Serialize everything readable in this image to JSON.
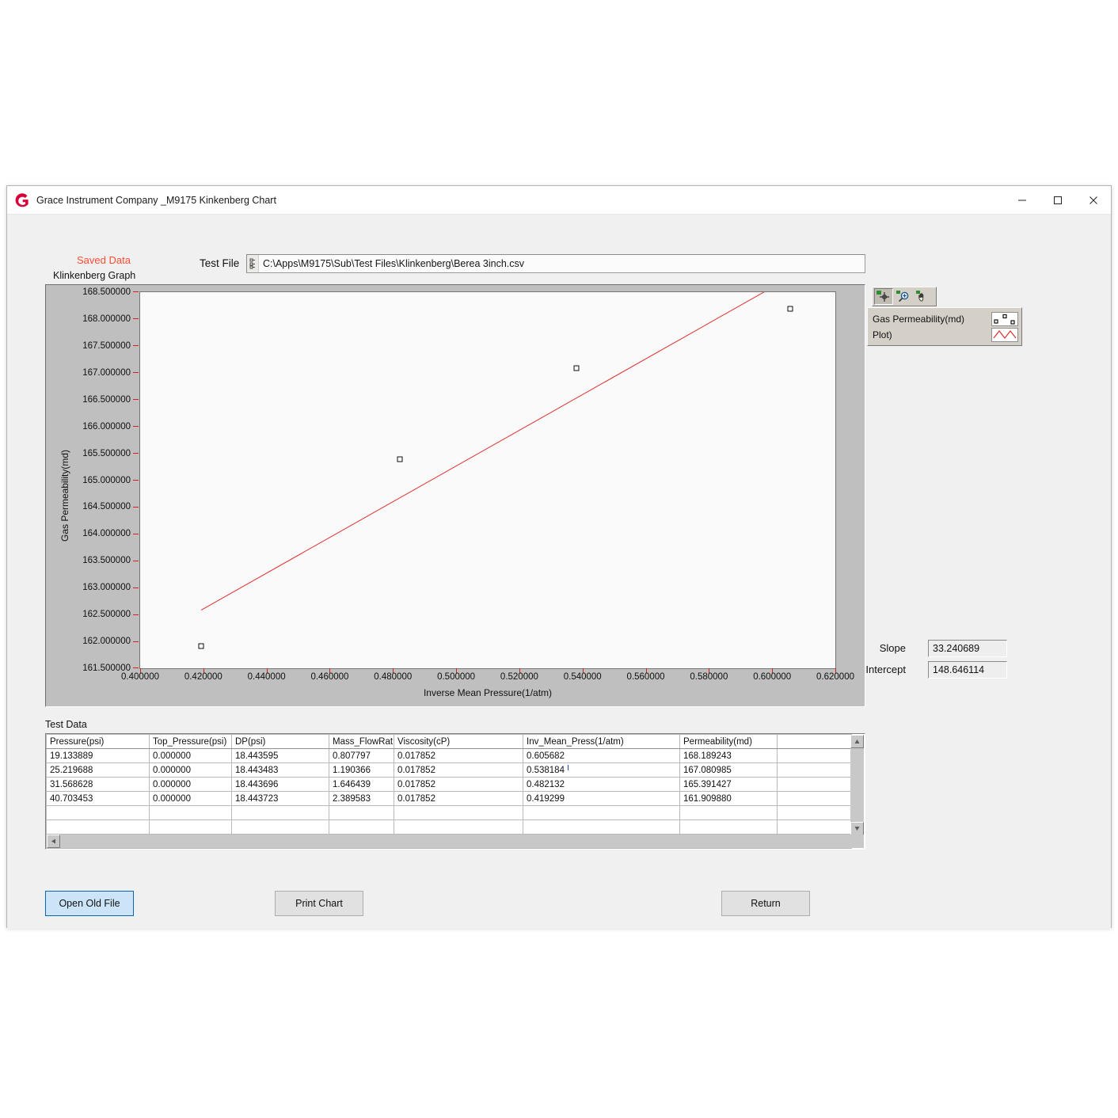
{
  "window": {
    "title": "Grace Instrument Company _M9175 Kinkenberg Chart",
    "logo_icon": "grace-g-logo",
    "minimize_icon": "minimize-icon",
    "maximize_icon": "maximize-icon",
    "close_icon": "close-icon"
  },
  "header": {
    "saved_data": "Saved Data",
    "test_file_label": "Test File",
    "test_file_path": "C:\\Apps\\M9175\\Sub\\Test Files\\Klinkenberg\\Berea 3inch.csv",
    "path_icon": "file-path-icon",
    "graph_label": "Klinkenberg Graph"
  },
  "toolbar": {
    "cursor_tool": "crosshair-cursor-icon",
    "zoom_tool": "zoom-magnifier-icon",
    "pan_tool": "pan-hand-icon",
    "active_tool": "crosshair-cursor-icon"
  },
  "legend": {
    "rows": [
      {
        "name": "Gas Permeability(md)",
        "swatch": "scatter-squares-icon"
      },
      {
        "name": "Plot)",
        "swatch": "red-line-icon"
      }
    ]
  },
  "fit": {
    "slope_label": "Slope",
    "slope_value": "33.240689",
    "intercept_label": "Intercept",
    "intercept_value": "148.646114"
  },
  "table": {
    "caption": "Test Data",
    "headers": [
      "Pressure(psi)",
      "Top_Pressure(psi)",
      "DP(psi)",
      "Mass_FlowRat",
      "Viscosity(cP)",
      "Inv_Mean_Press(1/atm)",
      "Permeability(md)",
      ""
    ],
    "rows": [
      [
        "19.133889",
        "0.000000",
        "18.443595",
        "0.807797",
        "0.017852",
        "0.605682",
        "168.189243",
        ""
      ],
      [
        "25.219688",
        "0.000000",
        "18.443483",
        "1.190366",
        "0.017852",
        "0.538184",
        "167.080985",
        ""
      ],
      [
        "31.568628",
        "0.000000",
        "18.443696",
        "1.646439",
        "0.017852",
        "0.482132",
        "165.391427",
        ""
      ],
      [
        "40.703453",
        "0.000000",
        "18.443723",
        "2.389583",
        "0.017852",
        "0.419299",
        "161.909880",
        ""
      ],
      [
        "",
        "",
        "",
        "",
        "",
        "",
        "",
        ""
      ],
      [
        "",
        "",
        "",
        "",
        "",
        "",
        "",
        ""
      ],
      [
        "",
        "",
        "",
        "",
        "",
        "",
        "",
        ""
      ]
    ]
  },
  "buttons": {
    "open_old_file": "Open Old File",
    "print_chart": "Print Chart",
    "return": "Return"
  },
  "colors": {
    "accent_red": "#ff4b33",
    "plot_line": "#e03030",
    "tick_red": "#d41f1f",
    "primary_button_bg": "#cce4f7",
    "primary_button_border": "#0a64b4"
  },
  "chart_data": {
    "type": "scatter",
    "title": "Klinkenberg Graph",
    "xlabel": "Inverse Mean Pressure(1/atm)",
    "ylabel": "Gas Permeability(md)",
    "xlim": [
      0.4,
      0.62
    ],
    "ylim": [
      161.5,
      168.5
    ],
    "xticks": [
      "0.400000",
      "0.420000",
      "0.440000",
      "0.460000",
      "0.480000",
      "0.500000",
      "0.520000",
      "0.540000",
      "0.560000",
      "0.580000",
      "0.600000",
      "0.620000"
    ],
    "yticks": [
      "168.500000",
      "168.000000",
      "167.500000",
      "167.000000",
      "166.500000",
      "166.000000",
      "165.500000",
      "165.000000",
      "164.500000",
      "164.000000",
      "163.500000",
      "163.000000",
      "162.500000",
      "162.000000",
      "161.500000"
    ],
    "grid": false,
    "legend_position": "top-right-outside",
    "series": [
      {
        "name": "Gas Permeability(md)",
        "type": "scatter",
        "marker": "open-square",
        "color": "#111111",
        "x": [
          0.605682,
          0.538184,
          0.482132,
          0.419299
        ],
        "y": [
          168.189243,
          167.080985,
          165.391427,
          161.90988
        ]
      },
      {
        "name": "Plot)",
        "type": "line",
        "color": "#e03030",
        "fit": "linear",
        "slope": 33.240689,
        "intercept": 148.646114,
        "x": [
          0.419299,
          0.605682
        ],
        "y": [
          162.582,
          168.777
        ]
      }
    ]
  }
}
